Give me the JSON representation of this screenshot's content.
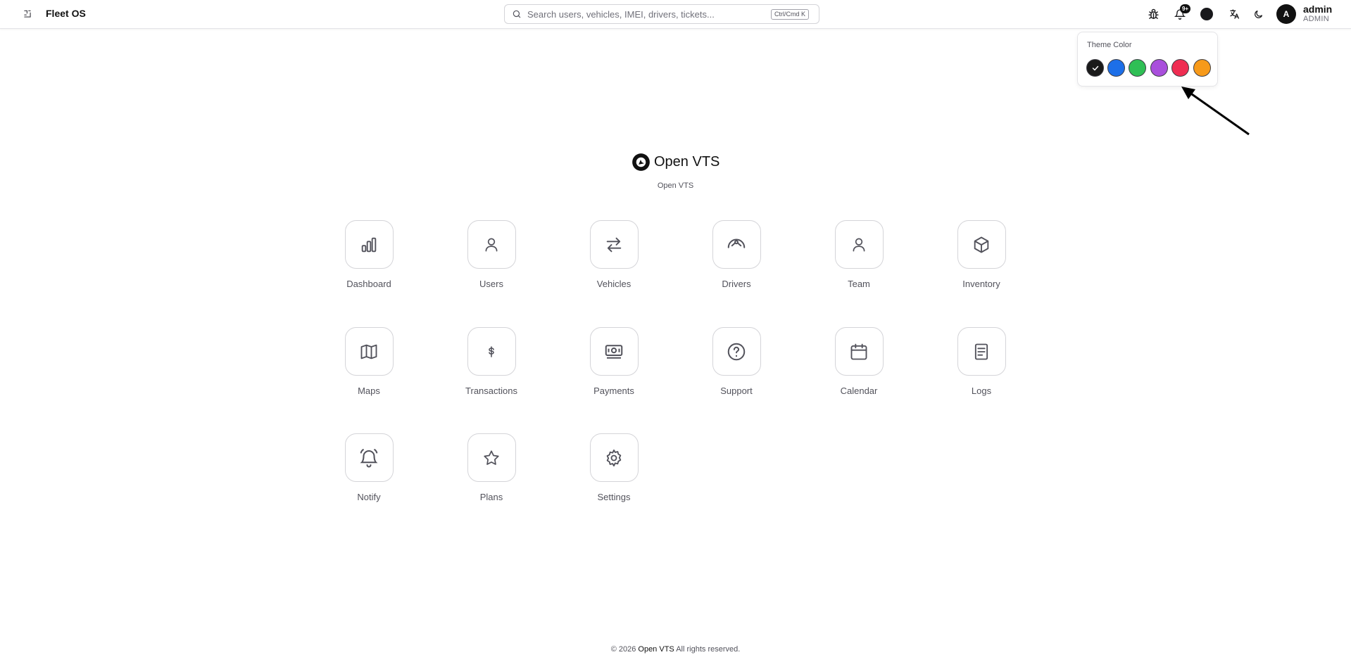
{
  "header": {
    "app_title": "Fleet OS",
    "search_placeholder": "Search users, vehicles, IMEI, drivers, tickets...",
    "search_shortcut": "Ctrl/Cmd K",
    "notification_badge": "9+",
    "user": {
      "avatar_initial": "A",
      "name": "admin",
      "role": "ADMIN"
    }
  },
  "theme_popover": {
    "title": "Theme Color",
    "selected": "black",
    "colors": [
      {
        "name": "black",
        "hex": "#1a1a1a"
      },
      {
        "name": "blue",
        "hex": "#1d6fe8"
      },
      {
        "name": "green",
        "hex": "#2fbf55"
      },
      {
        "name": "purple",
        "hex": "#a94fdc"
      },
      {
        "name": "red",
        "hex": "#ef2d52"
      },
      {
        "name": "orange",
        "hex": "#f79a1a"
      }
    ]
  },
  "brand": {
    "name_part1": "Open",
    "name_part2": "VTS",
    "subtitle": "Open VTS"
  },
  "apps": [
    {
      "label": "Dashboard",
      "icon": "bar-chart-icon"
    },
    {
      "label": "Users",
      "icon": "user-icon"
    },
    {
      "label": "Vehicles",
      "icon": "arrows-swap-icon"
    },
    {
      "label": "Drivers",
      "icon": "steering-wheel-icon"
    },
    {
      "label": "Team",
      "icon": "user-icon"
    },
    {
      "label": "Inventory",
      "icon": "box-icon"
    },
    {
      "label": "Maps",
      "icon": "map-icon"
    },
    {
      "label": "Transactions",
      "icon": "dollar-icon"
    },
    {
      "label": "Payments",
      "icon": "banknote-icon"
    },
    {
      "label": "Support",
      "icon": "help-circle-icon"
    },
    {
      "label": "Calendar",
      "icon": "calendar-icon"
    },
    {
      "label": "Logs",
      "icon": "document-icon"
    },
    {
      "label": "Notify",
      "icon": "bell-ring-icon"
    },
    {
      "label": "Plans",
      "icon": "star-icon"
    },
    {
      "label": "Settings",
      "icon": "gear-icon"
    }
  ],
  "footer": {
    "prefix": "© 2026",
    "brand": "Open VTS",
    "suffix": "All rights reserved."
  }
}
